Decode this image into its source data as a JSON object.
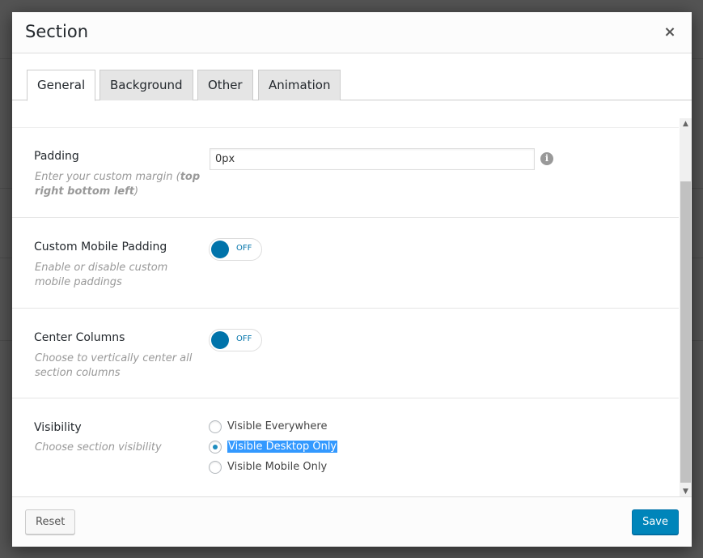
{
  "modal": {
    "title": "Section",
    "close_symbol": "×"
  },
  "tabs": [
    {
      "label": "General",
      "active": true
    },
    {
      "label": "Background",
      "active": false
    },
    {
      "label": "Other",
      "active": false
    },
    {
      "label": "Animation",
      "active": false
    }
  ],
  "settings": {
    "padding": {
      "label": "Padding",
      "desc_prefix": "Enter your custom margin (",
      "desc_bold": "top right bottom left",
      "desc_suffix": ")",
      "value": "0px",
      "info_symbol": "i"
    },
    "custom_mobile_padding": {
      "label": "Custom Mobile Padding",
      "desc": "Enable or disable custom mobile paddings",
      "toggle_state": "OFF"
    },
    "center_columns": {
      "label": "Center Columns",
      "desc": "Choose to vertically center all section columns",
      "toggle_state": "OFF"
    },
    "visibility": {
      "label": "Visibility",
      "desc": "Choose section visibility",
      "options": [
        {
          "label": "Visible Everywhere",
          "checked": false
        },
        {
          "label": "Visible Desktop Only",
          "checked": true
        },
        {
          "label": "Visible Mobile Only",
          "checked": false
        }
      ]
    }
  },
  "footer": {
    "reset_label": "Reset",
    "save_label": "Save"
  },
  "colors": {
    "accent": "#0073aa",
    "save_button": "#0085ba",
    "selection_highlight": "#3399ff"
  }
}
